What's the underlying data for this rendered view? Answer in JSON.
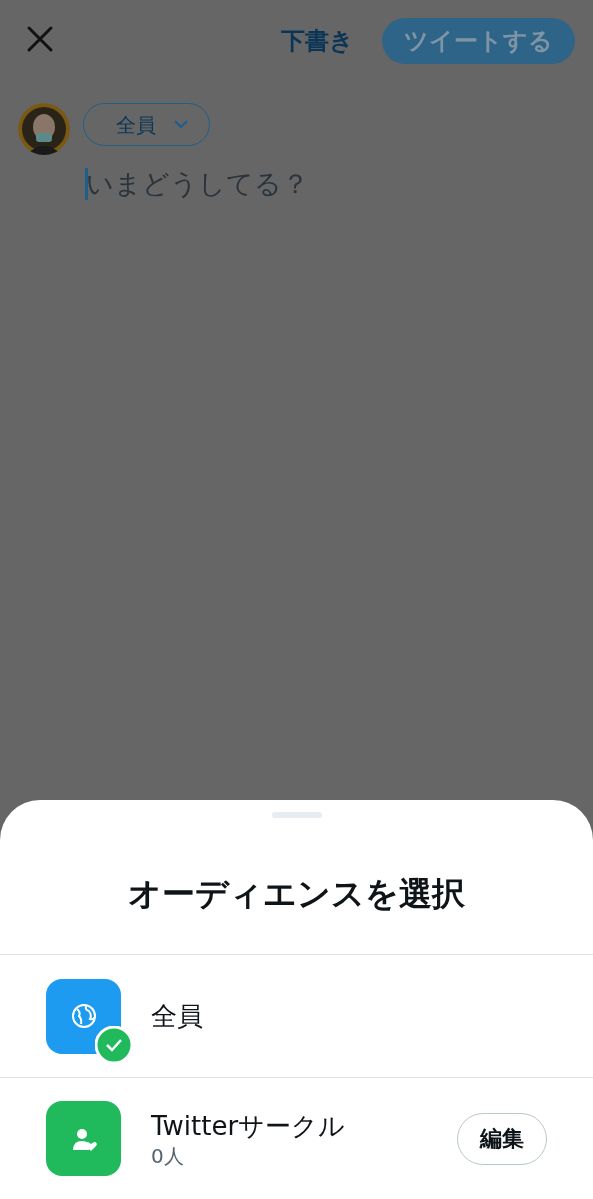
{
  "header": {
    "draft_button": "下書き",
    "tweet_button": {
      "label": "ツイートする",
      "disabled": true
    }
  },
  "composer": {
    "audience_button": "全員",
    "placeholder": "いまどうしてる？"
  },
  "sheet": {
    "title": "オーディエンスを選択",
    "options": [
      {
        "kind": "everyone",
        "label": "全員",
        "selected": true
      },
      {
        "kind": "circle",
        "label": "Twitterサークル",
        "count": "0人",
        "action": "編集",
        "selected": false
      }
    ]
  }
}
